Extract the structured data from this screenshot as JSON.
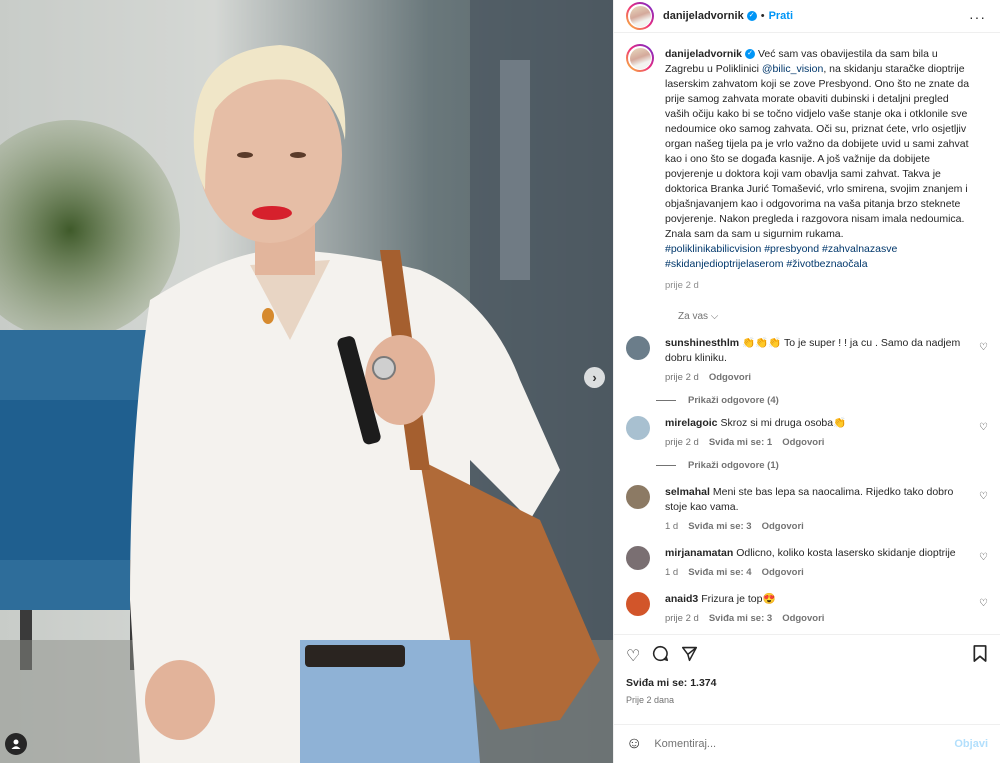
{
  "header": {
    "username": "danijeladvornik",
    "separator": "•",
    "follow_label": "Prati",
    "more_label": "···"
  },
  "caption": {
    "username": "danijeladvornik",
    "text_1": " Već sam vas obavijestila da sam bila u Zagrebu u Poliklinici ",
    "mention": "@bilic_vision",
    "text_2": ", na skidanju staračke dioptrije laserskim zahvatom koji se zove Presbyond. Ono što ne znate da prije samog zahvata morate obaviti dubinski i detaljni pregled vaših očiju kako bi se točno vidjelo vaše stanje oka i otklonile sve nedoumice oko samog zahvata. Oči su, priznat ćete, vrlo osjetljiv organ našeg tijela pa je vrlo važno da dobijete uvid u sami zahvat kao i ono što se događa kasnije. A još važnije da dobijete povjerenje u doktora koji vam obavlja sami zahvat. Takva je doktorica Branka Jurić Tomašević, vrlo smirena, svojim znanjem i objašnjavanjem kao i odgovorima na vaša pitanja brzo steknete povjerenje. Nakon pregleda i razgovora nisam imala nedoumica. Znala sam da sam u sigurnim rukama.",
    "hashtags": "#poliklinikabilicvision #presbyond #zahvalnazasve #skidanjedioptrijelaserom #životbeznaočala",
    "time": "prije 2 d"
  },
  "language_label": "Za vas ⌵",
  "comments": [
    {
      "user": "sunshinesthlm",
      "text": "👏👏👏 To je super ! ! ja cu . Samo da nadjem dobru kliniku.",
      "time": "prije 2 d",
      "likes": "",
      "reply": "Odgovori",
      "replies": "Prikaži odgovore (4)",
      "avatar_color": "#6b7d8a"
    },
    {
      "user": "mirelagoic",
      "text": "Skroz si mi druga osoba👏",
      "time": "prije 2 d",
      "likes": "Sviđa mi se: 1",
      "reply": "Odgovori",
      "replies": "Prikaži odgovore (1)",
      "avatar_color": "#a8c0d0"
    },
    {
      "user": "selmahal",
      "text": "Meni ste bas lepa sa naocalima. Rijedko tako dobro stoje kao vama.",
      "time": "1 d",
      "likes": "Sviđa mi se: 3",
      "reply": "Odgovori",
      "replies": "",
      "avatar_color": "#8c7a64"
    },
    {
      "user": "mirjanamatan",
      "text": "Odlicno, koliko kosta lasersko skidanje dioptrije",
      "time": "1 d",
      "likes": "Sviđa mi se: 4",
      "reply": "Odgovori",
      "replies": "",
      "avatar_color": "#7a6f72"
    },
    {
      "user": "anaid3",
      "text": "Frizura je top😍",
      "time": "prije 2 d",
      "likes": "Sviđa mi se: 3",
      "reply": "Odgovori",
      "replies": "",
      "avatar_color": "#d2552a"
    }
  ],
  "actions": {
    "likes_text": "Sviđa mi se: 1.374",
    "date_text": "Prije 2 dana"
  },
  "comment_box": {
    "placeholder": "Komentiraj...",
    "post_label": "Objavi"
  }
}
